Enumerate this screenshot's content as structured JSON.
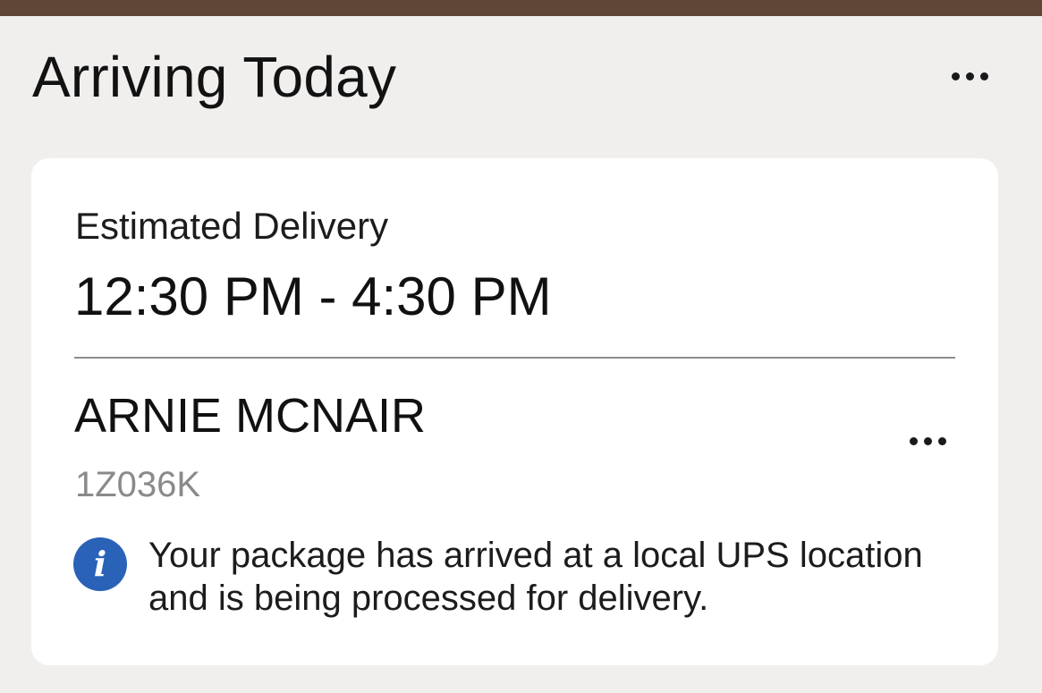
{
  "header": {
    "title": "Arriving Today",
    "more_icon": "more-horizontal-icon"
  },
  "card": {
    "estimated_label": "Estimated Delivery",
    "estimated_window": "12:30 PM - 4:30 PM",
    "recipient_name": "ARNIE MCNAIR",
    "tracking_number_visible": "1Z036K",
    "more_icon": "more-horizontal-icon",
    "info_icon": "info-icon",
    "status_message": "Your package has arrived at a local UPS location and is being processed for delivery."
  },
  "colors": {
    "top_bar": "#5f4636",
    "background": "#f1efee",
    "card": "#ffffff",
    "info_icon": "#2a62b8",
    "muted_text": "#8a8a8a"
  }
}
